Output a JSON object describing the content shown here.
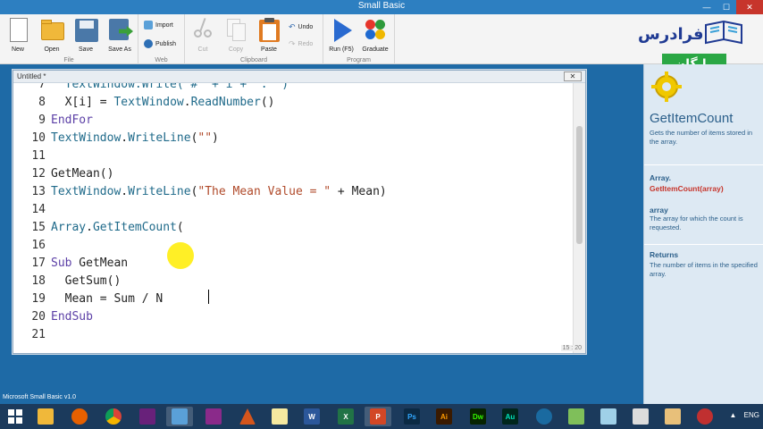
{
  "window": {
    "title": "Small Basic",
    "min": "—",
    "max": "☐",
    "close": "✕"
  },
  "ribbon": {
    "groups": {
      "file": "File",
      "web": "Web",
      "clipboard": "Clipboard",
      "program": "Program"
    },
    "buttons": {
      "new": "New",
      "open": "Open",
      "save": "Save",
      "save_as": "Save As",
      "import": "Import",
      "publish": "Publish",
      "cut": "Cut",
      "copy": "Copy",
      "paste": "Paste",
      "undo": "Undo",
      "redo": "Redo",
      "run": "Run (F5)",
      "graduate": "Graduate"
    }
  },
  "logo": {
    "text": "فرادرس",
    "badge": "رایگان"
  },
  "editor": {
    "tab_title": "Untitled *",
    "close": "✕",
    "row_col": "15 : 20",
    "lines": [
      {
        "n": "7",
        "tokens": [
          {
            "t": "  TextWindow.Write(\"#\" + i + \": \")",
            "c": "fn"
          }
        ]
      },
      {
        "n": "8",
        "tokens": [
          {
            "t": "  X[i] = ",
            "c": "plain"
          },
          {
            "t": "TextWindow",
            "c": "obj"
          },
          {
            "t": ".",
            "c": "plain"
          },
          {
            "t": "ReadNumber",
            "c": "fn"
          },
          {
            "t": "()",
            "c": "plain"
          }
        ]
      },
      {
        "n": "9",
        "tokens": [
          {
            "t": "EndFor",
            "c": "kw"
          }
        ]
      },
      {
        "n": "10",
        "tokens": [
          {
            "t": "TextWindow",
            "c": "obj"
          },
          {
            "t": ".",
            "c": "plain"
          },
          {
            "t": "WriteLine",
            "c": "fn"
          },
          {
            "t": "(",
            "c": "plain"
          },
          {
            "t": "\"\"",
            "c": "str"
          },
          {
            "t": ")",
            "c": "plain"
          }
        ]
      },
      {
        "n": "11",
        "tokens": []
      },
      {
        "n": "12",
        "tokens": [
          {
            "t": "GetMean()",
            "c": "plain"
          }
        ]
      },
      {
        "n": "13",
        "tokens": [
          {
            "t": "TextWindow",
            "c": "obj"
          },
          {
            "t": ".",
            "c": "plain"
          },
          {
            "t": "WriteLine",
            "c": "fn"
          },
          {
            "t": "(",
            "c": "plain"
          },
          {
            "t": "\"The Mean Value = \"",
            "c": "str"
          },
          {
            "t": " + Mean)",
            "c": "plain"
          }
        ]
      },
      {
        "n": "14",
        "tokens": []
      },
      {
        "n": "15",
        "tokens": [
          {
            "t": "Array",
            "c": "obj"
          },
          {
            "t": ".",
            "c": "plain"
          },
          {
            "t": "GetItemCount",
            "c": "fn"
          },
          {
            "t": "(",
            "c": "plain"
          }
        ]
      },
      {
        "n": "16",
        "tokens": []
      },
      {
        "n": "17",
        "tokens": [
          {
            "t": "Sub",
            "c": "kw"
          },
          {
            "t": " GetMean",
            "c": "plain"
          }
        ]
      },
      {
        "n": "18",
        "tokens": [
          {
            "t": "  GetSum()",
            "c": "plain"
          }
        ]
      },
      {
        "n": "19",
        "tokens": [
          {
            "t": "  Mean = Sum / N",
            "c": "plain"
          }
        ]
      },
      {
        "n": "20",
        "tokens": [
          {
            "t": "EndSub",
            "c": "kw"
          }
        ]
      },
      {
        "n": "21",
        "tokens": []
      }
    ]
  },
  "help": {
    "title": "GetItemCount",
    "description": "Gets the number of items stored in the array.",
    "signature_obj": "Array.",
    "signature_method": "GetItemCount(array)",
    "param_name": "array",
    "param_desc": "The array for which the count is requested.",
    "returns_label": "Returns",
    "returns_desc": "The number of items in the specified array."
  },
  "status": {
    "text": "Microsoft Small Basic v1.0"
  },
  "taskbar": {
    "apps": [
      "start-icon",
      "explorer-icon",
      "firefox-icon",
      "chrome-icon",
      "visual-studio-icon",
      "small-basic-icon",
      "winrar-icon",
      "matlab-icon",
      "notepad-icon",
      "word-icon",
      "excel-icon",
      "powerpoint-icon",
      "photoshop-icon",
      "illustrator-icon",
      "dreamweaver-icon",
      "audition-icon",
      "media-icon",
      "paint-icon",
      "notes-icon",
      "calculator-icon",
      "paint-brush-icon",
      "tool-icon"
    ],
    "ps": "Ps",
    "ai": "Ai",
    "dw": "Dw",
    "au": "Au",
    "lang": "ENG"
  },
  "colors": {
    "accent": "#2d7fc1",
    "keyword": "#5b3fa6",
    "object": "#1f6a8a",
    "string": "#b04a2a",
    "help_text": "#2b5f8a",
    "method_red": "#c7352b",
    "badge_green": "#2aa744"
  }
}
